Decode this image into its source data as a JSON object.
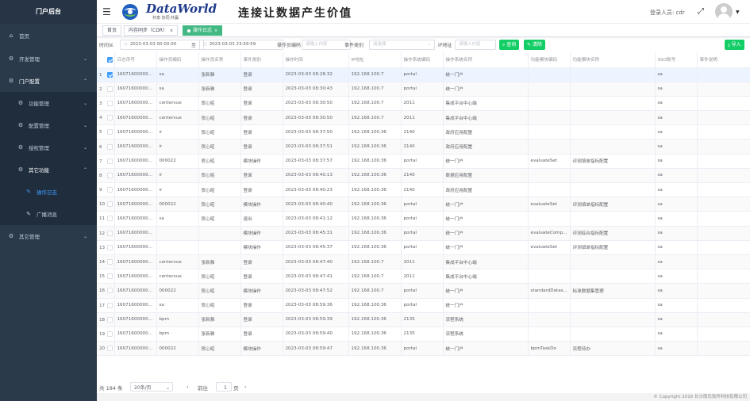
{
  "sidebar": {
    "title": "门户后台",
    "items": [
      {
        "label": "首页"
      },
      {
        "label": "开发管理"
      },
      {
        "label": "门户配置"
      },
      {
        "label": "功能管理"
      },
      {
        "label": "配置管理"
      },
      {
        "label": "授权管理"
      },
      {
        "label": "其它功能"
      },
      {
        "label": "操作日志"
      },
      {
        "label": "广播消息"
      },
      {
        "label": "其它管理"
      }
    ]
  },
  "header": {
    "brand": "DataWorld",
    "brand_sub": "共享·协同·共赢",
    "slogan": "连接让数据产生价值",
    "login_user": "登录人员: cdr"
  },
  "tags": {
    "home": "首页",
    "sync": "内存同步（CDR）",
    "active": "操作日志"
  },
  "filters": {
    "time_label": "时间从",
    "start_time": "2023-03-03 00:00:00",
    "to_label": "至",
    "end_time": "2023-03-03 23:59:59",
    "operator_label": "操作员编码",
    "operator_placeholder": "请输入内容",
    "event_label": "事件类别",
    "event_placeholder": "请选择",
    "ip_label": "IP地址",
    "ip_placeholder": "请输入内容",
    "query_button": "查询",
    "clear_button": "清除",
    "import_button": "导入"
  },
  "table": {
    "headers": [
      "",
      "日志序号",
      "操作员编码",
      "操作员名称",
      "事件类别",
      "操作时间",
      "IP地址",
      "操作系统编码",
      "操作系统名称",
      "功能模块编码",
      "功能模块名称",
      "SSO账号",
      "事件说明"
    ],
    "rows": [
      [
        "1",
        "16071600000...",
        "sa",
        "张新雅",
        "登录",
        "2023-03-03 08:28:32",
        "192.168.100.7",
        "portal",
        "统一门户",
        "",
        "",
        "sa",
        ""
      ],
      [
        "2",
        "16071600000...",
        "sa",
        "张新雅",
        "登录",
        "2023-03-03 08:30:43",
        "192.168.100.7",
        "portal",
        "统一门户",
        "",
        "",
        "sa",
        ""
      ],
      [
        "3",
        "16071600000...",
        "centervue",
        "贺心昭",
        "登录",
        "2023-03-03 08:30:50",
        "192.168.100.7",
        "2011",
        "集成平台中心端",
        "",
        "",
        "sa",
        ""
      ],
      [
        "4",
        "16071600000...",
        "centervue",
        "贺心昭",
        "登录",
        "2023-03-03 08:30:50",
        "192.168.100.7",
        "2011",
        "集成平台中心端",
        "",
        "",
        "sa",
        ""
      ],
      [
        "5",
        "16071600000...",
        "ir",
        "贺心昭",
        "登录",
        "2023-03-03 08:37:50",
        "192.168.100.36",
        "2140",
        "政府应用配置",
        "",
        "",
        "sa",
        ""
      ],
      [
        "6",
        "16071600000...",
        "ir",
        "贺心昭",
        "登录",
        "2023-03-03 08:37:51",
        "192.168.100.36",
        "2140",
        "政府应用配置",
        "",
        "",
        "sa",
        ""
      ],
      [
        "7",
        "16071600000...",
        "000022",
        "贺心昭",
        "模块操作",
        "2023-03-03 08:37:57",
        "192.168.100.36",
        "portal",
        "统一门户",
        "evaluateSet",
        "评测填单指标配置",
        "sa",
        ""
      ],
      [
        "8",
        "16071600000...",
        "ir",
        "贺心昭",
        "登录",
        "2023-03-03 08:40:13",
        "192.168.100.36",
        "2140",
        "数据应用配置",
        "",
        "",
        "sa",
        ""
      ],
      [
        "9",
        "16071600000...",
        "ir",
        "贺心昭",
        "登录",
        "2023-03-03 08:40:23",
        "192.168.100.36",
        "2140",
        "政府应用配置",
        "",
        "",
        "sa",
        ""
      ],
      [
        "10",
        "16071600000...",
        "000022",
        "贺心昭",
        "模块操作",
        "2023-03-03 08:40:40",
        "192.168.100.36",
        "portal",
        "统一门户",
        "evaluateSet",
        "评测填单指标配置",
        "sa",
        ""
      ],
      [
        "11",
        "16071600000...",
        "sa",
        "贺心昭",
        "退出",
        "2023-03-03 08:41:12",
        "192.168.100.36",
        "portal",
        "统一门户",
        "",
        "",
        "sa",
        ""
      ],
      [
        "12",
        "16071600000...",
        "",
        "",
        "模块操作",
        "2023-03-03 08:45:31",
        "192.168.100.36",
        "portal",
        "统一门户",
        "evaluateComp...",
        "评测综合指标配置",
        "sa",
        ""
      ],
      [
        "13",
        "16071600000...",
        "",
        "",
        "模块操作",
        "2023-03-03 08:45:37",
        "192.168.100.36",
        "portal",
        "统一门户",
        "evaluateSet",
        "评测填单指标配置",
        "sa",
        ""
      ],
      [
        "14",
        "16071600000...",
        "centervue",
        "张新雅",
        "登录",
        "2023-03-03 08:47:40",
        "192.168.100.7",
        "2011",
        "集成平台中心端",
        "",
        "",
        "sa",
        ""
      ],
      [
        "15",
        "16071600000...",
        "centervue",
        "贺心昭",
        "登录",
        "2023-03-03 08:47:41",
        "192.168.100.7",
        "2011",
        "集成平台中心端",
        "",
        "",
        "sa",
        ""
      ],
      [
        "16",
        "16071600000...",
        "000022",
        "贺心昭",
        "模块操作",
        "2023-03-03 08:47:52",
        "192.168.100.7",
        "portal",
        "统一门户",
        "standardDatas...",
        "标准数据集管理",
        "sa",
        ""
      ],
      [
        "17",
        "16071600000...",
        "sa",
        "贺心昭",
        "登录",
        "2023-03-03 08:59:36",
        "192.168.100.36",
        "portal",
        "统一门户",
        "",
        "",
        "sa",
        ""
      ],
      [
        "18",
        "16071600000...",
        "bpm",
        "张新雅",
        "登录",
        "2023-03-03 08:59:39",
        "192.168.100.36",
        "2135",
        "流程系统",
        "",
        "",
        "sa",
        ""
      ],
      [
        "19",
        "16071600000...",
        "bpm",
        "张新雅",
        "登录",
        "2023-03-03 08:59:40",
        "192.168.100.36",
        "2135",
        "流程系统",
        "",
        "",
        "sa",
        ""
      ],
      [
        "20",
        "16071600000...",
        "000022",
        "贺心昭",
        "模块操作",
        "2023-03-03 08:59:47",
        "192.168.100.36",
        "portal",
        "统一门户",
        "bpmTaskDo",
        "流程待办",
        "sa",
        ""
      ]
    ]
  },
  "pager": {
    "total": "共 184 条",
    "page_size": "20条/页",
    "goto": "前往",
    "page": "1",
    "page_suffix": "页"
  },
  "footer": {
    "copyright": "© Copyright 2016 长沙厚氏软件科技有限公司"
  }
}
